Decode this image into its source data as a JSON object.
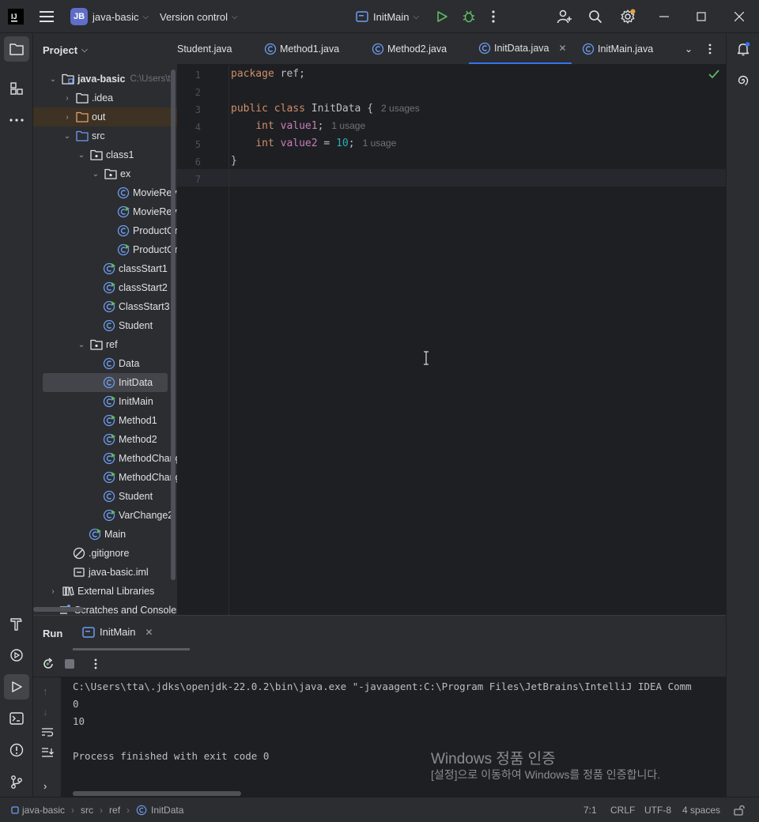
{
  "titlebar": {
    "project_badge": "JB",
    "project_name": "java-basic",
    "vcs_label": "Version control",
    "run_config": "InitMain"
  },
  "project_panel": {
    "title": "Project",
    "tree": [
      {
        "label": "java-basic",
        "extra": "C:\\Users\\tt",
        "bold": true
      },
      {
        "label": ".idea"
      },
      {
        "label": "out"
      },
      {
        "label": "src"
      },
      {
        "label": "class1"
      },
      {
        "label": "ex"
      },
      {
        "label": "MovieRevi"
      },
      {
        "label": "MovieRevi"
      },
      {
        "label": "ProductOr"
      },
      {
        "label": "ProductOr"
      },
      {
        "label": "classStart1"
      },
      {
        "label": "classStart2"
      },
      {
        "label": "ClassStart3"
      },
      {
        "label": "Student"
      },
      {
        "label": "ref"
      },
      {
        "label": "Data"
      },
      {
        "label": "InitData"
      },
      {
        "label": "InitMain"
      },
      {
        "label": "Method1"
      },
      {
        "label": "Method2"
      },
      {
        "label": "MethodChang"
      },
      {
        "label": "MethodChang"
      },
      {
        "label": "Student"
      },
      {
        "label": "VarChange2"
      },
      {
        "label": "Main"
      },
      {
        "label": ".gitignore"
      },
      {
        "label": "java-basic.iml"
      },
      {
        "label": "External Libraries"
      },
      {
        "label": "Scratches and Consoles"
      }
    ]
  },
  "tabs": [
    {
      "label": "Student.java"
    },
    {
      "label": "Method1.java"
    },
    {
      "label": "Method2.java"
    },
    {
      "label": "InitData.java",
      "active": true
    },
    {
      "label": "InitMain.java"
    }
  ],
  "editor": {
    "lines": [
      {
        "n": "1",
        "code": "package ref;"
      },
      {
        "n": "2",
        "code": ""
      },
      {
        "n": "3",
        "code": "public class InitData {",
        "hint": "2 usages"
      },
      {
        "n": "4",
        "code": "    int value1;",
        "hint": "1 usage"
      },
      {
        "n": "5",
        "code": "    int value2 = 10;",
        "hint": "1 usage"
      },
      {
        "n": "6",
        "code": "}"
      },
      {
        "n": "7",
        "code": ""
      }
    ]
  },
  "run": {
    "title": "Run",
    "tab": "InitMain",
    "output": [
      "C:\\Users\\tta\\.jdks\\openjdk-22.0.2\\bin\\java.exe \"-javaagent:C:\\Program Files\\JetBrains\\IntelliJ IDEA Comm",
      "0",
      "10",
      "",
      "Process finished with exit code 0"
    ]
  },
  "watermark": {
    "line1": "Windows 정품 인증",
    "line2": "[설정]으로 이동하여 Windows를 정품 인증합니다."
  },
  "statusbar": {
    "crumbs": [
      "java-basic",
      "src",
      "ref",
      "InitData"
    ],
    "position": "7:1",
    "line_sep": "CRLF",
    "encoding": "UTF-8",
    "indent": "4 spaces"
  },
  "colors": {
    "accent": "#3574f0",
    "bg": "#1e1f22",
    "panel": "#2b2d30",
    "run_green": "#5fb865"
  }
}
